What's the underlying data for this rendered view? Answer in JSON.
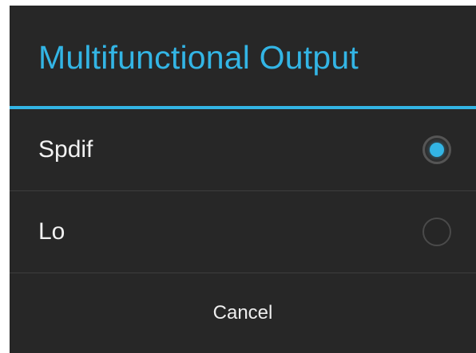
{
  "dialog": {
    "title": "Multifunctional Output",
    "accent_color": "#33b5e5",
    "background_color": "#272727",
    "options": [
      {
        "label": "Spdif",
        "selected": true
      },
      {
        "label": "Lo",
        "selected": false
      }
    ],
    "cancel_label": "Cancel"
  }
}
